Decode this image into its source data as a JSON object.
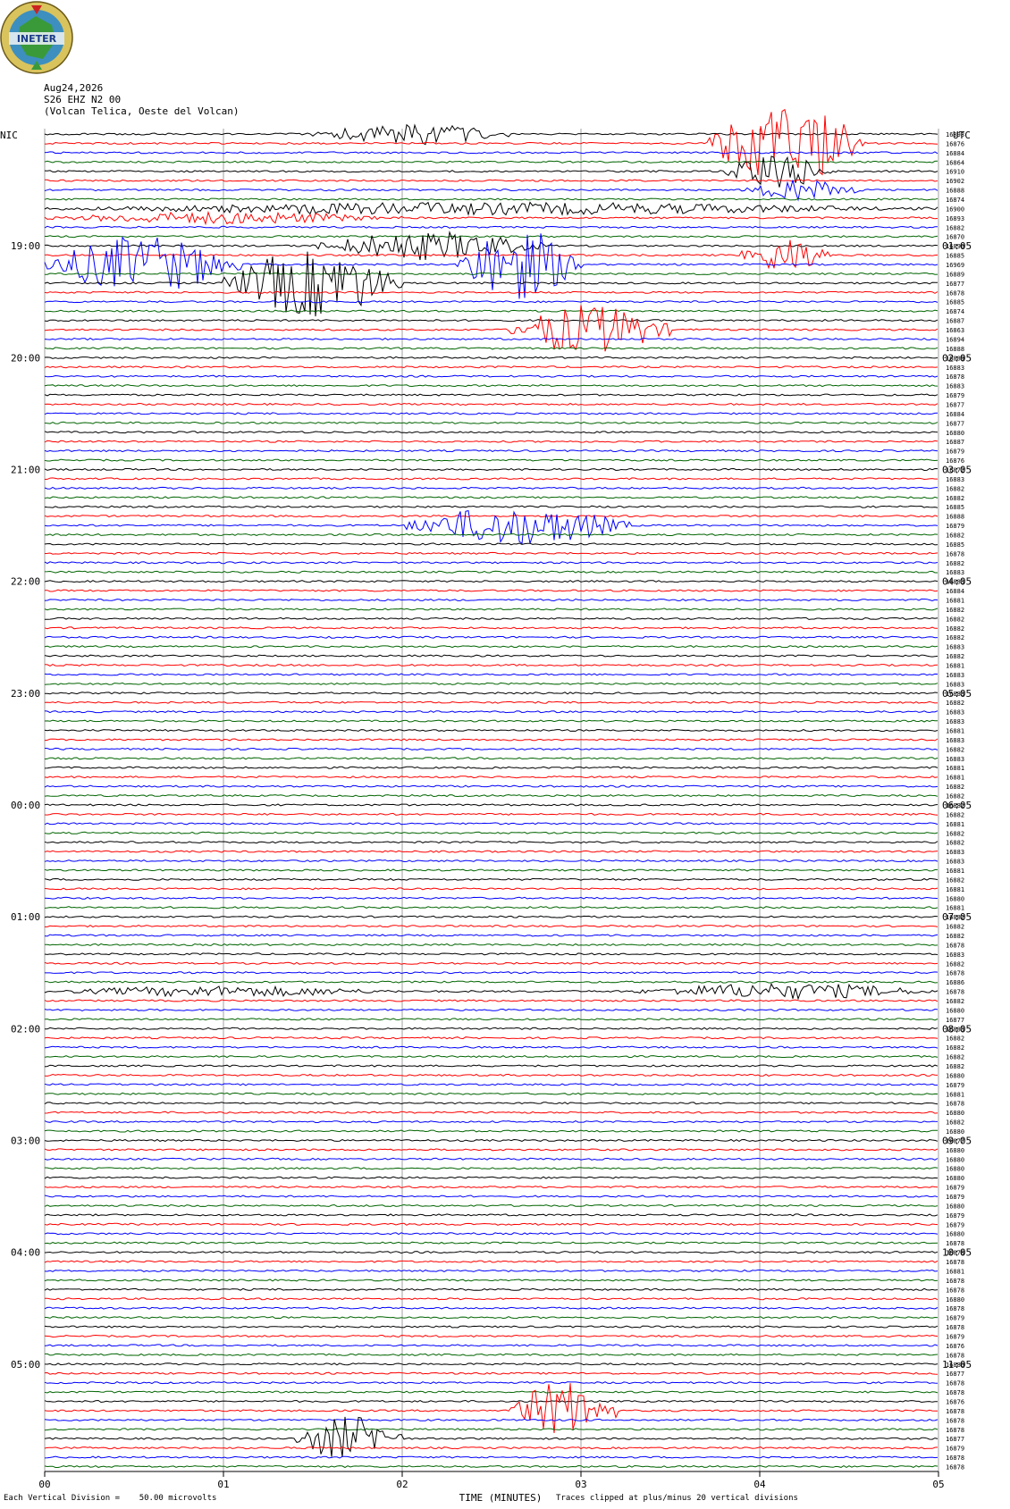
{
  "header": {
    "logo_text": "INETER",
    "date": "Aug24,2026",
    "station": "S26 EHZ N2 00",
    "location": "(Volcan Telica, Oeste del Volcan)",
    "left_zone": "NIC",
    "right_zone": "UTC"
  },
  "footer": {
    "vertical_division": "Each Vertical Division =    50.00 microvolts",
    "x_title": "TIME (MINUTES)",
    "clip_note": "Traces clipped at plus/minus 20 vertical divisions"
  },
  "colors": {
    "cycle": [
      "#000000",
      "#ff0000",
      "#0000ff",
      "#006400"
    ],
    "grid": "#7a7a7a"
  },
  "chart_data": {
    "type": "helicorder",
    "x_ticks": [
      "00",
      "01",
      "02",
      "03",
      "04",
      "05"
    ],
    "xlim": [
      0,
      5
    ],
    "trace_count": 144,
    "minutes_per_trace": 5,
    "left_hour_labels": [
      "19:00",
      "20:00",
      "21:00",
      "22:00",
      "23:00",
      "00:00",
      "01:00",
      "02:00",
      "03:00",
      "04:00",
      "05:00"
    ],
    "right_hour_labels": [
      "01:05",
      "02:05",
      "03:05",
      "04:05",
      "05:05",
      "06:05",
      "07:05",
      "08:05",
      "09:05",
      "10:05",
      "11:05"
    ],
    "hour_label_first_trace": 12,
    "traces_per_hour": 12,
    "trace_values": [
      16898,
      16876,
      16884,
      16864,
      16910,
      16902,
      16888,
      16874,
      16900,
      16893,
      16882,
      16870,
      16890,
      16885,
      16969,
      16889,
      16877,
      16878,
      16885,
      16874,
      16887,
      16863,
      16894,
      16888,
      16889,
      16883,
      16878,
      16883,
      16879,
      16877,
      16884,
      16877,
      16880,
      16887,
      16879,
      16876,
      16872,
      16883,
      16882,
      16882,
      16885,
      16888,
      16879,
      16882,
      16885,
      16878,
      16882,
      16883,
      16883,
      16884,
      16881,
      16882,
      16882,
      16882,
      16882,
      16883,
      16882,
      16881,
      16883,
      16883,
      16883,
      16882,
      16883,
      16883,
      16881,
      16883,
      16882,
      16883,
      16881,
      16881,
      16882,
      16882,
      16882,
      16882,
      16881,
      16882,
      16882,
      16883,
      16883,
      16881,
      16882,
      16881,
      16880,
      16881,
      16882,
      16882,
      16882,
      16878,
      16883,
      16882,
      16878,
      16886,
      16878,
      16882,
      16880,
      16877,
      16883,
      16882,
      16882,
      16882,
      16882,
      16880,
      16879,
      16881,
      16878,
      16880,
      16882,
      16880,
      16877,
      16880,
      16880,
      16880,
      16880,
      16879,
      16879,
      16880,
      16879,
      16879,
      16880,
      16878,
      16878,
      16878,
      16881,
      16878,
      16878,
      16880,
      16878,
      16879,
      16878,
      16879,
      16876,
      16878,
      16880,
      16877,
      16878,
      16878,
      16876,
      16878,
      16878,
      16878,
      16877,
      16879,
      16878,
      16878
    ],
    "events": [
      {
        "trace": 0,
        "start": 1.5,
        "end": 2.6,
        "amp": 12
      },
      {
        "trace": 1,
        "start": 3.7,
        "end": 4.6,
        "amp": 45
      },
      {
        "trace": 4,
        "start": 3.8,
        "end": 4.4,
        "amp": 22
      },
      {
        "trace": 6,
        "start": 3.9,
        "end": 4.6,
        "amp": 12
      },
      {
        "trace": 8,
        "start": 0.0,
        "end": 5.0,
        "amp": 7
      },
      {
        "trace": 9,
        "start": 0.0,
        "end": 2.0,
        "amp": 7
      },
      {
        "trace": 12,
        "start": 1.5,
        "end": 2.8,
        "amp": 16
      },
      {
        "trace": 13,
        "start": 3.9,
        "end": 4.4,
        "amp": 20
      },
      {
        "trace": 14,
        "start": 0.0,
        "end": 1.1,
        "amp": 32
      },
      {
        "trace": 14,
        "start": 2.3,
        "end": 3.0,
        "amp": 40
      },
      {
        "trace": 16,
        "start": 1.0,
        "end": 2.0,
        "amp": 38
      },
      {
        "trace": 21,
        "start": 2.6,
        "end": 3.5,
        "amp": 28
      },
      {
        "trace": 42,
        "start": 2.0,
        "end": 3.3,
        "amp": 22
      },
      {
        "trace": 92,
        "start": 0.0,
        "end": 2.0,
        "amp": 6
      },
      {
        "trace": 92,
        "start": 3.3,
        "end": 5.0,
        "amp": 9
      },
      {
        "trace": 137,
        "start": 2.6,
        "end": 3.2,
        "amp": 32
      },
      {
        "trace": 140,
        "start": 1.4,
        "end": 2.0,
        "amp": 25
      }
    ]
  }
}
